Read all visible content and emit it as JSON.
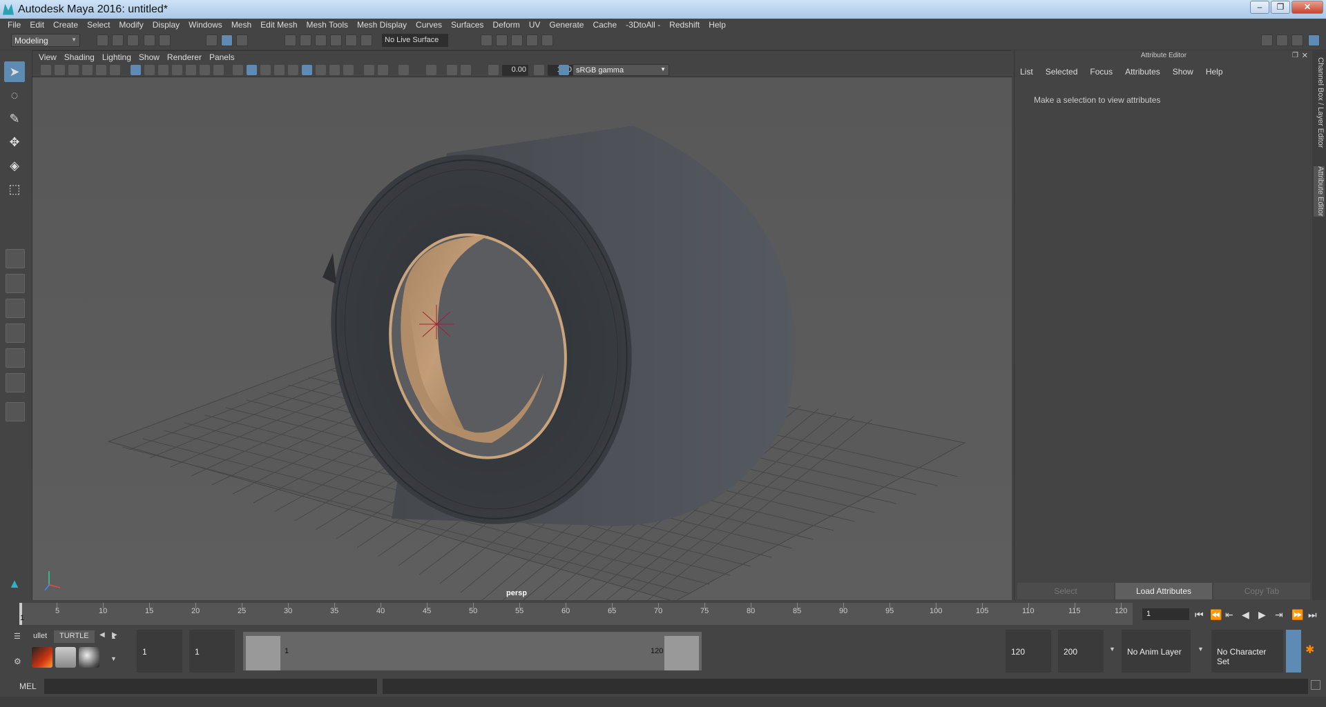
{
  "window": {
    "title": "Autodesk Maya 2016: untitled*"
  },
  "menubar": [
    "File",
    "Edit",
    "Create",
    "Select",
    "Modify",
    "Display",
    "Windows",
    "Mesh",
    "Edit Mesh",
    "Mesh Tools",
    "Mesh Display",
    "Curves",
    "Surfaces",
    "Deform",
    "UV",
    "Generate",
    "Cache",
    "-3DtoAll -",
    "Redshift",
    "Help"
  ],
  "status_line": {
    "mode": "Modeling",
    "live_surface": "No Live Surface"
  },
  "viewport": {
    "menu": [
      "View",
      "Shading",
      "Lighting",
      "Show",
      "Renderer",
      "Panels"
    ],
    "near_value": "0.00",
    "far_value": "1.00",
    "color_space": "sRGB gamma",
    "camera_label": "persp"
  },
  "attribute_editor": {
    "title": "Attribute Editor",
    "menu": [
      "List",
      "Selected",
      "Focus",
      "Attributes",
      "Show",
      "Help"
    ],
    "message": "Make a selection to view attributes",
    "buttons": {
      "select": "Select",
      "load": "Load Attributes",
      "copy": "Copy Tab"
    }
  },
  "side_tabs": {
    "channel_box": "Channel Box / Layer Editor",
    "attribute_editor": "Attribute Editor"
  },
  "timeline": {
    "ticks": [
      "5",
      "10",
      "15",
      "20",
      "25",
      "30",
      "35",
      "40",
      "45",
      "50",
      "55",
      "60",
      "65",
      "70",
      "75",
      "80",
      "85",
      "90",
      "95",
      "100",
      "105",
      "110",
      "115",
      "120"
    ],
    "start_label": "1",
    "end_label": "120",
    "current_frame": "1"
  },
  "range": {
    "start": "1",
    "anim_start": "1",
    "slider_start": "1",
    "slider_end": "120",
    "end": "120",
    "anim_end": "200",
    "anim_layer": "No Anim Layer",
    "character_set": "No Character Set"
  },
  "shelf": {
    "tabs": [
      "ullet",
      "TURTLE"
    ]
  },
  "command_line": {
    "label": "MEL"
  }
}
